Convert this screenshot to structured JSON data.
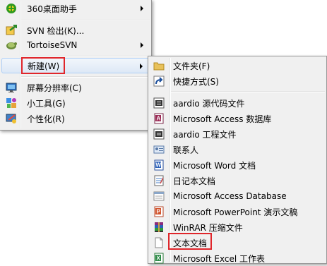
{
  "context_menu": {
    "items": [
      {
        "label": "360桌面助手",
        "icon": "360-assistant-icon",
        "has_submenu": true
      },
      {
        "label": "SVN 检出(K)...",
        "icon": "svn-checkout-icon",
        "has_submenu": false
      },
      {
        "label": "TortoiseSVN",
        "icon": "tortoisesvn-icon",
        "has_submenu": true
      },
      {
        "label": "新建(W)",
        "icon": "",
        "has_submenu": true,
        "highlighted": true
      },
      {
        "label": "屏幕分辨率(C)",
        "icon": "screen-resolution-icon",
        "has_submenu": false
      },
      {
        "label": "小工具(G)",
        "icon": "gadgets-icon",
        "has_submenu": false
      },
      {
        "label": "个性化(R)",
        "icon": "personalize-icon",
        "has_submenu": false
      }
    ]
  },
  "new_submenu": {
    "items": [
      {
        "label": "文件夹(F)",
        "icon": "folder-icon"
      },
      {
        "label": "快捷方式(S)",
        "icon": "shortcut-icon"
      },
      {
        "label": "aardio 源代码文件",
        "icon": "aardio-source-icon"
      },
      {
        "label": "Microsoft Access 数据库",
        "icon": "access-db-icon"
      },
      {
        "label": "aardio 工程文件",
        "icon": "aardio-project-icon"
      },
      {
        "label": "联系人",
        "icon": "contact-icon"
      },
      {
        "label": "Microsoft Word 文档",
        "icon": "word-doc-icon"
      },
      {
        "label": "日记本文档",
        "icon": "journal-doc-icon"
      },
      {
        "label": "Microsoft Access Database",
        "icon": "access-database-icon"
      },
      {
        "label": "Microsoft PowerPoint 演示文稿",
        "icon": "powerpoint-icon"
      },
      {
        "label": "WinRAR 压缩文件",
        "icon": "winrar-icon"
      },
      {
        "label": "文本文档",
        "icon": "text-doc-icon"
      },
      {
        "label": "Microsoft Excel 工作表",
        "icon": "excel-icon"
      }
    ]
  },
  "colors": {
    "highlight_border": "#e0262b",
    "menu_bg": "#f0f0f0"
  }
}
